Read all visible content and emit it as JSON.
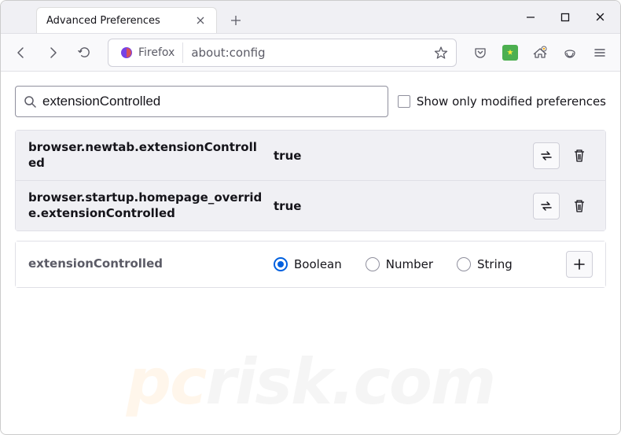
{
  "window": {
    "tab_title": "Advanced Preferences"
  },
  "toolbar": {
    "identity_label": "Firefox",
    "url": "about:config"
  },
  "search": {
    "value": "extensionControlled",
    "checkbox_label": "Show only modified preferences"
  },
  "prefs": [
    {
      "name": "browser.newtab.extensionControlled",
      "value": "true"
    },
    {
      "name": "browser.startup.homepage_override.extensionControlled",
      "value": "true"
    }
  ],
  "new_pref": {
    "name": "extensionControlled",
    "types": [
      "Boolean",
      "Number",
      "String"
    ],
    "selected": 0
  },
  "watermark": {
    "a": "pc",
    "b": "risk.com"
  }
}
